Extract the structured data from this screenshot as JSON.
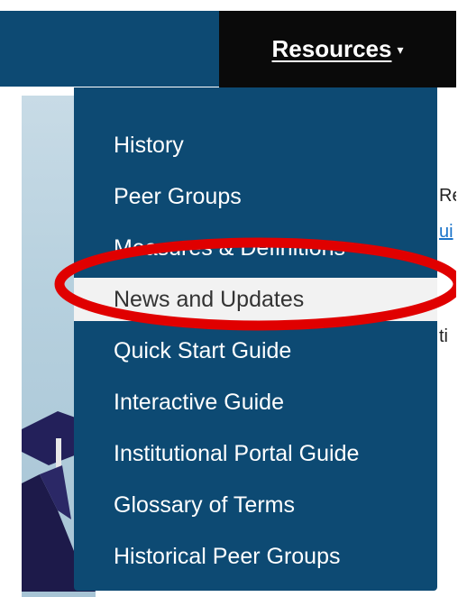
{
  "nav": {
    "resources_label": "Resources",
    "caret": "▾"
  },
  "dropdown": {
    "items": [
      {
        "label": "History"
      },
      {
        "label": "Peer Groups"
      },
      {
        "label": "Measures & Definitions"
      },
      {
        "label": "News and Updates"
      },
      {
        "label": "Quick Start Guide"
      },
      {
        "label": "Interactive Guide"
      },
      {
        "label": "Institutional Portal Guide"
      },
      {
        "label": "Glossary of Terms"
      },
      {
        "label": "Historical Peer Groups"
      }
    ],
    "highlighted_index": 3
  },
  "background_text": {
    "line1": "Re",
    "line2": "ui",
    "line3": "ti"
  },
  "colors": {
    "nav_bg": "#0d4a73",
    "tab_bg": "#0a0a0a",
    "highlight_bg": "#f2f2f2",
    "annotation": "#e00000"
  }
}
